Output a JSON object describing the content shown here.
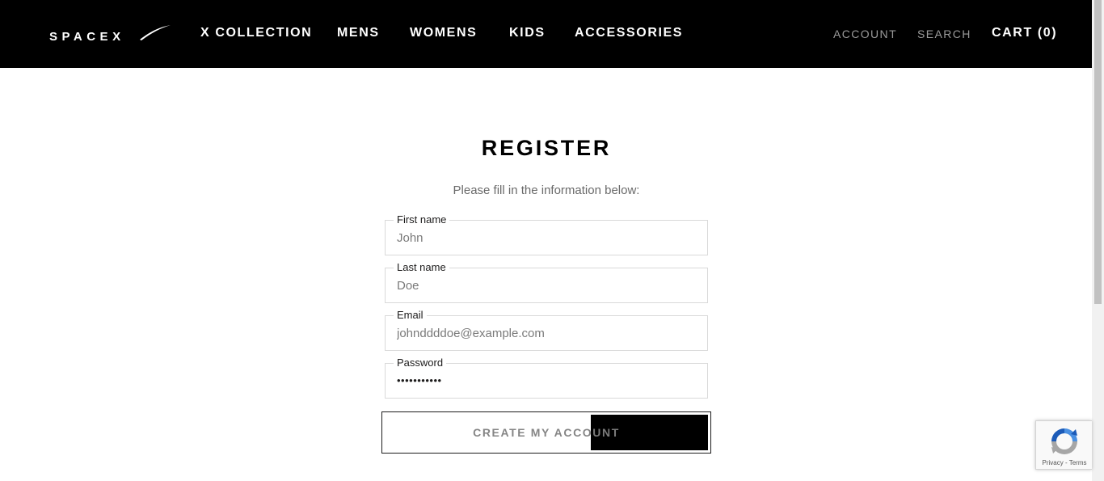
{
  "header": {
    "logo_text": "SPACEX",
    "nav": [
      "X COLLECTION",
      "MENS",
      "WOMENS",
      "KIDS",
      "ACCESSORIES"
    ],
    "account": "ACCOUNT",
    "search": "SEARCH",
    "cart": "CART (0)"
  },
  "form": {
    "title": "REGISTER",
    "subtitle": "Please fill in the information below:",
    "first_name": {
      "label": "First name",
      "value": "John"
    },
    "last_name": {
      "label": "Last name",
      "value": "Doe"
    },
    "email": {
      "label": "Email",
      "value": "johnddddoe@example.com"
    },
    "password": {
      "label": "Password",
      "value": "•••••••••••"
    },
    "submit": "CREATE MY ACCOUNT"
  },
  "recaptcha": {
    "privacy": "Privacy",
    "separator": " - ",
    "terms": "Terms"
  },
  "colors": {
    "header_bg": "#000000",
    "header_text": "#ffffff",
    "muted_nav": "#9a9a9a",
    "field_border": "#d9d9d9"
  }
}
